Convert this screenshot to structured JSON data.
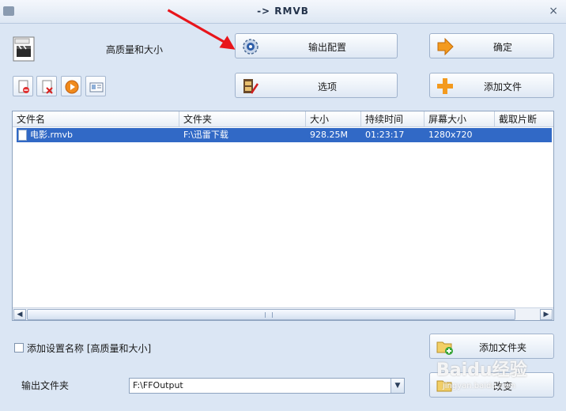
{
  "window": {
    "title": "-> RMVB",
    "close_glyph": "×"
  },
  "profile": {
    "label": "高质量和大小",
    "icon": "real-media-icon"
  },
  "toolbar_small": [
    {
      "name": "remove-file-button",
      "icon": "doc-remove-icon"
    },
    {
      "name": "delete-button",
      "icon": "doc-delete-icon"
    },
    {
      "name": "play-button",
      "icon": "play-icon"
    },
    {
      "name": "info-button",
      "icon": "info-card-icon"
    }
  ],
  "buttons": {
    "output_config": "输出配置",
    "options": "选项",
    "ok": "确定",
    "add_file": "添加文件",
    "add_folder": "添加文件夹",
    "change": "改变"
  },
  "table": {
    "headers": [
      "文件名",
      "文件夹",
      "大小",
      "持续时间",
      "屏幕大小",
      "截取片断"
    ],
    "rows": [
      {
        "name": "电影.rmvb",
        "folder": "F:\\迅雷下载",
        "size": "928.25M",
        "duration": "01:23:17",
        "screen": "1280x720",
        "clip": ""
      }
    ]
  },
  "options": {
    "add_setting_name": "添加设置名称 [高质量和大小]",
    "add_setting_checked": false
  },
  "output": {
    "label": "输出文件夹",
    "folder": "F:\\FFOutput"
  },
  "watermark": {
    "text": "Baidu经验",
    "sub": "jingyan.baidu.com"
  },
  "colors": {
    "background": "#dbe6f4",
    "selection": "#3169c6",
    "arrow": "#e8151b"
  }
}
